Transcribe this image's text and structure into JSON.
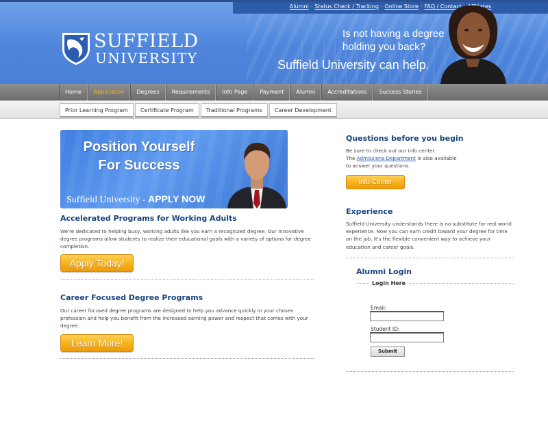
{
  "utility_nav": {
    "links": [
      "Alumni",
      "Status Check / Tracking",
      "Online Store",
      "FAQ / Contact",
      "Affiliates"
    ],
    "separator": "·"
  },
  "header": {
    "logo_line1": "SUFFIELD",
    "logo_line2": "UNIVERSITY",
    "tagline_question_line1": "Is not having a degree",
    "tagline_question_line2": "holding you back?",
    "tagline_answer": "Suffield University can help."
  },
  "main_nav": {
    "items": [
      "Home",
      "Application",
      "Degrees",
      "Requirements",
      "Info Page",
      "Payment",
      "Alumni",
      "Accreditations",
      "Success Stories"
    ],
    "active": "Application",
    "active_color": "#f5b01c"
  },
  "sub_nav": {
    "items": [
      "Prior Learning Program",
      "Certificate Program",
      "Traditional Programs",
      "Career Development"
    ]
  },
  "banner": {
    "headline_line1": "Position Yourself",
    "headline_line2": "For Success",
    "cta_prefix": "Suffield University - ",
    "cta_bold": "APPLY NOW"
  },
  "accelerated": {
    "title": "Accelerated Programs for Working Adults",
    "body": "We're dedicated to helping busy, working adults like you earn a recognized degree. Our innovative degree programs allow students to realize their educational goals with a variety of options for degree completion.",
    "button": "Apply Today!"
  },
  "career": {
    "title": "Career Focused Degree Programs",
    "body": "Our career focused degree programs are designed to help you advance quickly in your chosen profession and help you benefit from the increased earning power and respect that comes with your degree.",
    "button": "Learn More!"
  },
  "questions": {
    "title": "Questions before you begin",
    "line1": "Be sure to check out our info center.",
    "line2_prefix": "The ",
    "line2_link": "Admissions Department",
    "line2_suffix": " is also available",
    "line3": "to answer your questions.",
    "button": "Info Center"
  },
  "experience": {
    "title": "Experience",
    "body": "Suffield University understands there is no substitute for real world experience. Now you can earn credit toward your degree for time on the job. It's the flexible convenient way to achieve your education and career goals."
  },
  "alumni_login": {
    "title": "Alumni Login",
    "legend": "Login Here",
    "email_label": "Email:",
    "email_value": "",
    "student_id_label": "Student ID:",
    "student_id_value": "",
    "submit": "Submit"
  },
  "colors": {
    "header_blue": "#4f86dc",
    "title_navy": "#17437f",
    "button_orange": "#f7b31e",
    "link_blue": "#2a5db0"
  }
}
